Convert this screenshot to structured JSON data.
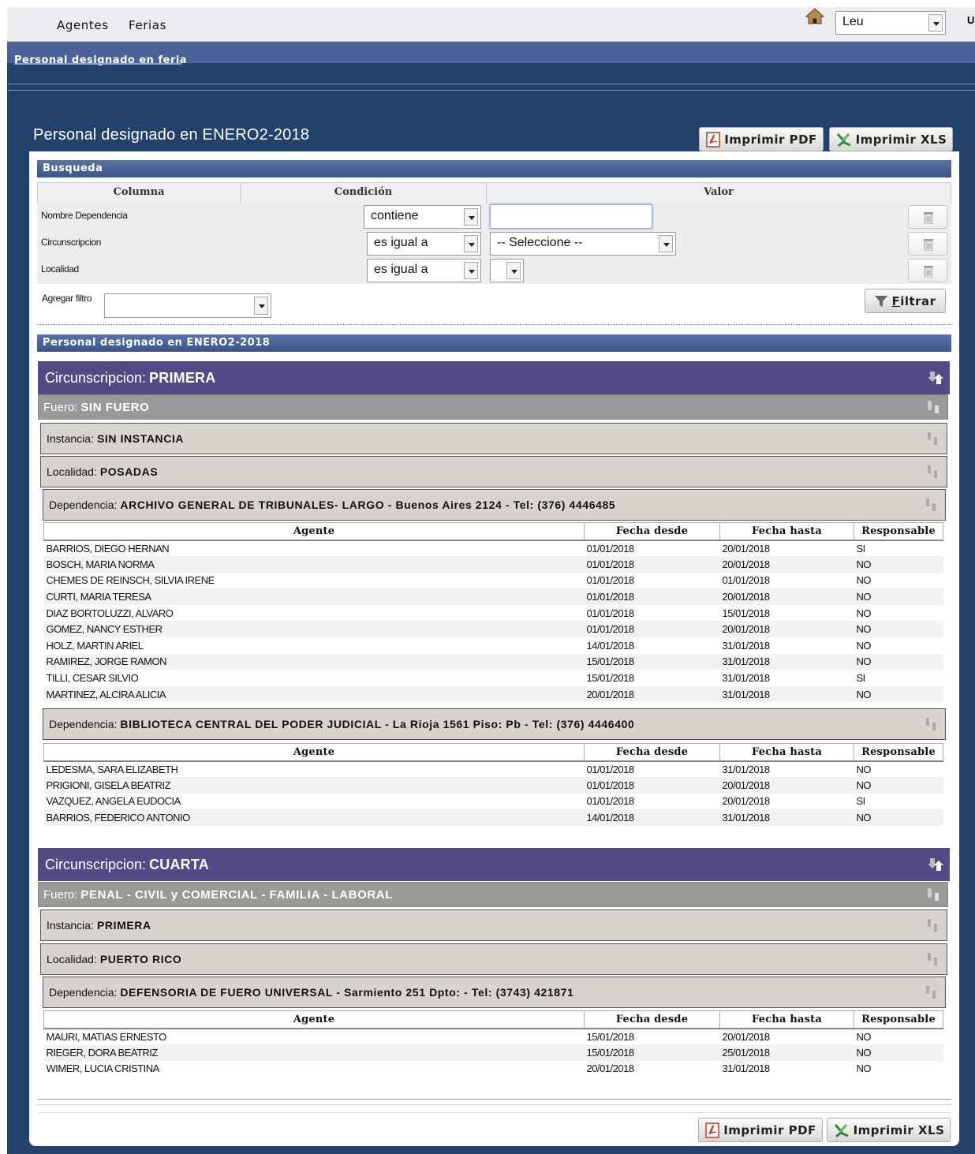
{
  "nav": {
    "items": [
      "Agentes",
      "Ferias"
    ],
    "user_select": "Leu",
    "user_char": "U"
  },
  "band": {
    "title": "Personal designado en feria"
  },
  "page": {
    "title": "Personal designado en ENERO2-2018",
    "pdf_label": "Imprimir PDF",
    "xls_label": "Imprimir XLS"
  },
  "search": {
    "title": "Busqueda",
    "columns": [
      "Columna",
      "Condición",
      "Valor"
    ],
    "rows": [
      {
        "label": "Nombre Dependencia",
        "condition": "contiene",
        "value": ""
      },
      {
        "label": "Circunscripcion",
        "condition": "es igual a",
        "value": "-- Seleccione --"
      },
      {
        "label": "Localidad",
        "condition": "es igual a",
        "value": ""
      }
    ],
    "add_filter_label": "Agregar filtro",
    "filter_button_key": "F",
    "filter_button_rest": "iltrar"
  },
  "results": {
    "title": "Personal designado en ENERO2-2018",
    "circ_label": "Circunscripcion:",
    "fuero_label": "Fuero:",
    "inst_label": "Instancia:",
    "loc_label": "Localidad:",
    "dep_label": "Dependencia:",
    "table_headers": [
      "Agente",
      "Fecha desde",
      "Fecha hasta",
      "Responsable"
    ],
    "groups": [
      {
        "circ": "PRIMERA",
        "fuero": "SIN FUERO",
        "instancia": "SIN INSTANCIA",
        "localidad": "POSADAS",
        "dependencias": [
          {
            "name": "ARCHIVO GENERAL DE TRIBUNALES- LARGO - Buenos Aires 2124 - Tel: (376) 4446485",
            "rows": [
              [
                "BARRIOS, DIEGO HERNAN",
                "01/01/2018",
                "20/01/2018",
                "SI"
              ],
              [
                "BOSCH, MARIA NORMA",
                "01/01/2018",
                "20/01/2018",
                "NO"
              ],
              [
                "CHEMES DE REINSCH, SILVIA IRENE",
                "01/01/2018",
                "01/01/2018",
                "NO"
              ],
              [
                "CURTI, MARIA TERESA",
                "01/01/2018",
                "20/01/2018",
                "NO"
              ],
              [
                "DIAZ BORTOLUZZI, ALVARO",
                "01/01/2018",
                "15/01/2018",
                "NO"
              ],
              [
                "GOMEZ, NANCY ESTHER",
                "01/01/2018",
                "20/01/2018",
                "NO"
              ],
              [
                "HOLZ, MARTIN ARIEL",
                "14/01/2018",
                "31/01/2018",
                "NO"
              ],
              [
                "RAMIREZ, JORGE RAMON",
                "15/01/2018",
                "31/01/2018",
                "NO"
              ],
              [
                "TILLI, CESAR SILVIO",
                "15/01/2018",
                "31/01/2018",
                "SI"
              ],
              [
                "MARTINEZ, ALCIRA ALICIA",
                "20/01/2018",
                "31/01/2018",
                "NO"
              ]
            ]
          },
          {
            "name": "BIBLIOTECA CENTRAL DEL PODER JUDICIAL - La Rioja 1561 Piso: Pb - Tel: (376) 4446400",
            "rows": [
              [
                "LEDESMA, SARA ELIZABETH",
                "01/01/2018",
                "31/01/2018",
                "NO"
              ],
              [
                "PRIGIONI, GISELA BEATRIZ",
                "01/01/2018",
                "20/01/2018",
                "NO"
              ],
              [
                "VAZQUEZ, ANGELA EUDOCIA",
                "01/01/2018",
                "20/01/2018",
                "SI"
              ],
              [
                "BARRIOS, FEDERICO ANTONIO",
                "14/01/2018",
                "31/01/2018",
                "NO"
              ]
            ]
          }
        ]
      },
      {
        "circ": "CUARTA",
        "fuero": "PENAL - CIVIL y COMERCIAL - FAMILIA - LABORAL",
        "instancia": "PRIMERA",
        "localidad": "PUERTO RICO",
        "dependencias": [
          {
            "name": "DEFENSORIA DE FUERO UNIVERSAL - Sarmiento 251 Dpto: - Tel: (3743) 421871",
            "rows": [
              [
                "MAURI, MATIAS ERNESTO",
                "15/01/2018",
                "20/01/2018",
                "NO"
              ],
              [
                "RIEGER, DORA BEATRIZ",
                "15/01/2018",
                "25/01/2018",
                "NO"
              ],
              [
                "WIMER, LUCIA CRISTINA",
                "20/01/2018",
                "31/01/2018",
                "NO"
              ]
            ]
          }
        ]
      }
    ]
  },
  "colors": {
    "navy": "#22416b",
    "band": "#4a6298",
    "circ": "#554a86",
    "fuero": "#999999",
    "inst": "#d8d4cd"
  },
  "icons": [
    "home-icon",
    "pdf-icon",
    "xls-icon",
    "trash-icon",
    "funnel-icon",
    "sort-icon"
  ]
}
